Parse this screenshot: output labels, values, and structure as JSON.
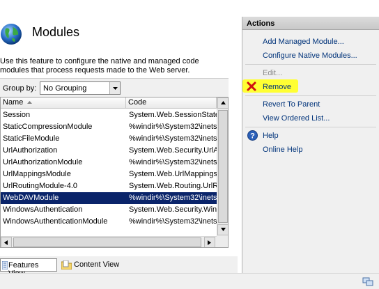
{
  "header": {
    "title": "Modules"
  },
  "description": "Use this feature to configure the native and managed code modules that process requests made to the Web server.",
  "group_by": {
    "label": "Group by:",
    "value": "No Grouping"
  },
  "grid": {
    "columns": [
      "Name",
      "Code"
    ],
    "rows": [
      {
        "name": "Session",
        "code": "System.Web.SessionState"
      },
      {
        "name": "StaticCompressionModule",
        "code": "%windir%\\System32\\inets"
      },
      {
        "name": "StaticFileModule",
        "code": "%windir%\\System32\\inets"
      },
      {
        "name": "UrlAuthorization",
        "code": "System.Web.Security.UrlA"
      },
      {
        "name": "UrlAuthorizationModule",
        "code": "%windir%\\System32\\inets"
      },
      {
        "name": "UrlMappingsModule",
        "code": "System.Web.UrlMappingsM"
      },
      {
        "name": "UrlRoutingModule-4.0",
        "code": "System.Web.Routing.UrlRo"
      },
      {
        "name": "WebDAVModule",
        "code": "%windir%\\System32\\inets",
        "selected": true
      },
      {
        "name": "WindowsAuthentication",
        "code": "System.Web.Security.Wind"
      },
      {
        "name": "WindowsAuthenticationModule",
        "code": "%windir%\\System32\\inets"
      }
    ]
  },
  "view_tabs": {
    "features": "Features View",
    "content": "Content View"
  },
  "actions": {
    "title": "Actions",
    "add_managed": "Add Managed Module...",
    "configure_native": "Configure Native Modules...",
    "edit": "Edit...",
    "remove": "Remove",
    "revert": "Revert To Parent",
    "view_ordered": "View Ordered List...",
    "help": "Help",
    "online_help": "Online Help"
  },
  "colors": {
    "selection": "#0a246a",
    "highlight": "#ffff33",
    "link": "#00337a",
    "remove_icon": "#d01010"
  },
  "icons": [
    "globe-icon",
    "sort-up-icon",
    "dropdown-arrow-icon",
    "remove-x-icon",
    "help-icon",
    "features-view-icon",
    "content-view-icon"
  ]
}
